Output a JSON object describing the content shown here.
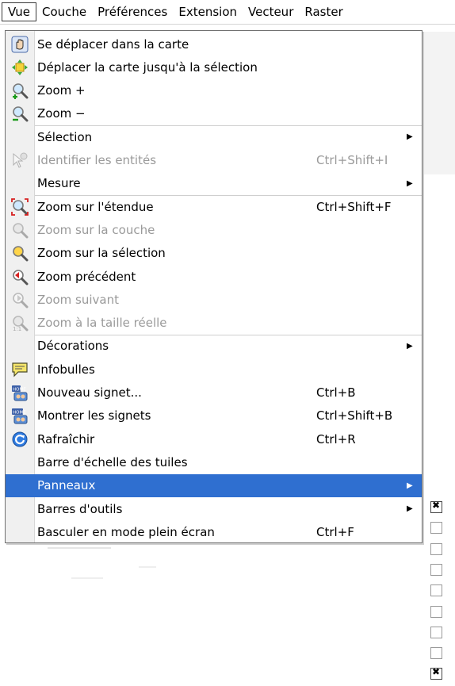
{
  "menubar": {
    "items": [
      "Vue",
      "Couche",
      "Préférences",
      "Extension",
      "Vecteur",
      "Raster"
    ]
  },
  "menu": {
    "items": [
      {
        "icon": "hand-icon",
        "label": "Se déplacer dans la carte",
        "shortcut": "",
        "submenu": false,
        "disabled": false,
        "highlighted": false
      },
      {
        "icon": "pan-to-selection-icon",
        "label": "Déplacer la carte jusqu'à la sélection",
        "shortcut": "",
        "submenu": false,
        "disabled": false,
        "highlighted": false
      },
      {
        "icon": "zoom-in-icon",
        "label": "Zoom +",
        "shortcut": "",
        "submenu": false,
        "disabled": false,
        "highlighted": false
      },
      {
        "icon": "zoom-out-icon",
        "label": "Zoom −",
        "shortcut": "",
        "submenu": false,
        "disabled": false,
        "highlighted": false
      },
      {
        "icon": "",
        "label": "Sélection",
        "shortcut": "",
        "submenu": true,
        "disabled": false,
        "highlighted": false
      },
      {
        "icon": "identify-icon",
        "label": "Identifier les entités",
        "shortcut": "Ctrl+Shift+I",
        "submenu": false,
        "disabled": true,
        "highlighted": false
      },
      {
        "icon": "",
        "label": "Mesure",
        "shortcut": "",
        "submenu": true,
        "disabled": false,
        "highlighted": false
      },
      {
        "icon": "zoom-full-icon",
        "label": "Zoom sur l'étendue",
        "shortcut": "Ctrl+Shift+F",
        "submenu": false,
        "disabled": false,
        "highlighted": false
      },
      {
        "icon": "zoom-layer-icon",
        "label": "Zoom sur la couche",
        "shortcut": "",
        "submenu": false,
        "disabled": true,
        "highlighted": false
      },
      {
        "icon": "zoom-selection-icon",
        "label": "Zoom sur la sélection",
        "shortcut": "",
        "submenu": false,
        "disabled": false,
        "highlighted": false
      },
      {
        "icon": "zoom-last-icon",
        "label": "Zoom précédent",
        "shortcut": "",
        "submenu": false,
        "disabled": false,
        "highlighted": false
      },
      {
        "icon": "zoom-next-icon",
        "label": "Zoom suivant",
        "shortcut": "",
        "submenu": false,
        "disabled": true,
        "highlighted": false
      },
      {
        "icon": "zoom-actual-icon",
        "label": "Zoom à la taille réelle",
        "shortcut": "",
        "submenu": false,
        "disabled": true,
        "highlighted": false
      },
      {
        "icon": "",
        "label": "Décorations",
        "shortcut": "",
        "submenu": true,
        "disabled": false,
        "highlighted": false
      },
      {
        "icon": "tooltip-icon",
        "label": "Infobulles",
        "shortcut": "",
        "submenu": false,
        "disabled": false,
        "highlighted": false
      },
      {
        "icon": "new-bookmark-icon",
        "label": "Nouveau signet...",
        "shortcut": "Ctrl+B",
        "submenu": false,
        "disabled": false,
        "highlighted": false
      },
      {
        "icon": "show-bookmarks-icon",
        "label": "Montrer les signets",
        "shortcut": "Ctrl+Shift+B",
        "submenu": false,
        "disabled": false,
        "highlighted": false
      },
      {
        "icon": "refresh-icon",
        "label": "Rafraîchir",
        "shortcut": "Ctrl+R",
        "submenu": false,
        "disabled": false,
        "highlighted": false
      },
      {
        "icon": "",
        "label": "Barre d'échelle des tuiles",
        "shortcut": "",
        "submenu": false,
        "disabled": false,
        "highlighted": false
      },
      {
        "icon": "",
        "label": "Panneaux",
        "shortcut": "",
        "submenu": true,
        "disabled": false,
        "highlighted": true
      },
      {
        "icon": "",
        "label": "Barres d'outils",
        "shortcut": "",
        "submenu": true,
        "disabled": false,
        "highlighted": false
      },
      {
        "icon": "",
        "label": "Basculer en mode plein écran",
        "shortcut": "Ctrl+F",
        "submenu": false,
        "disabled": false,
        "highlighted": false
      }
    ]
  },
  "submenu_checkboxes": [
    true,
    false,
    false,
    false,
    false,
    false,
    false,
    false,
    true
  ],
  "colors": {
    "highlight": "#2f6fd0",
    "disabled": "#9a9a9a"
  }
}
